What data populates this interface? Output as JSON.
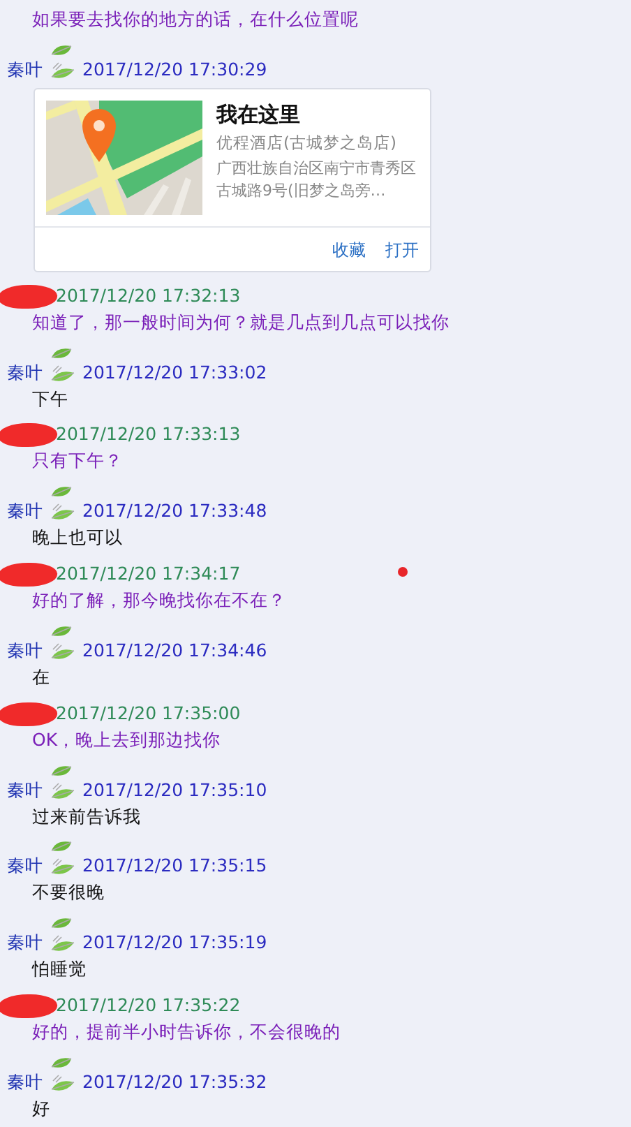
{
  "entries": [
    {
      "kind": "message",
      "mine": false,
      "text": "如果要去找你的地方的话，在什么位置呢"
    },
    {
      "kind": "header",
      "mine": true,
      "sender": "秦叶",
      "time": "2017/12/20 17:30:29"
    },
    {
      "kind": "location",
      "title": "我在这里",
      "place": "优程酒店(古城梦之岛店)",
      "address": "广西壮族自治区南宁市青秀区古城路9号(旧梦之岛旁…",
      "actions": [
        "收藏",
        "打开"
      ]
    },
    {
      "kind": "header",
      "mine": false,
      "time": "2017/12/20 17:32:13"
    },
    {
      "kind": "message",
      "mine": false,
      "text": "知道了，那一般时间为何？就是几点到几点可以找你"
    },
    {
      "kind": "header",
      "mine": true,
      "sender": "秦叶",
      "time": "2017/12/20 17:33:02"
    },
    {
      "kind": "message",
      "mine": true,
      "text": "下午"
    },
    {
      "kind": "header",
      "mine": false,
      "time": "2017/12/20 17:33:13"
    },
    {
      "kind": "message",
      "mine": false,
      "text": "只有下午？"
    },
    {
      "kind": "header",
      "mine": true,
      "sender": "秦叶",
      "time": "2017/12/20 17:33:48"
    },
    {
      "kind": "message",
      "mine": true,
      "text": "晚上也可以"
    },
    {
      "kind": "header",
      "mine": false,
      "time": "2017/12/20 17:34:17"
    },
    {
      "kind": "message",
      "mine": false,
      "text": "好的了解，那今晚找你在不在？"
    },
    {
      "kind": "header",
      "mine": true,
      "sender": "秦叶",
      "time": "2017/12/20 17:34:46"
    },
    {
      "kind": "message",
      "mine": true,
      "text": "在"
    },
    {
      "kind": "header",
      "mine": false,
      "time": "2017/12/20 17:35:00"
    },
    {
      "kind": "message",
      "mine": false,
      "text": "OK，晚上去到那边找你"
    },
    {
      "kind": "header",
      "mine": true,
      "sender": "秦叶",
      "time": "2017/12/20 17:35:10"
    },
    {
      "kind": "message",
      "mine": true,
      "text": "过来前告诉我"
    },
    {
      "kind": "header",
      "mine": true,
      "sender": "秦叶",
      "time": "2017/12/20 17:35:15"
    },
    {
      "kind": "message",
      "mine": true,
      "text": "不要很晚"
    },
    {
      "kind": "header",
      "mine": true,
      "sender": "秦叶",
      "time": "2017/12/20 17:35:19"
    },
    {
      "kind": "message",
      "mine": true,
      "text": "怕睡觉"
    },
    {
      "kind": "header",
      "mine": false,
      "time": "2017/12/20 17:35:22"
    },
    {
      "kind": "message",
      "mine": false,
      "text": "好的，提前半小时告诉你，不会很晚的"
    },
    {
      "kind": "header",
      "mine": true,
      "sender": "秦叶",
      "time": "2017/12/20 17:35:32"
    },
    {
      "kind": "message",
      "mine": true,
      "text": "好"
    }
  ]
}
